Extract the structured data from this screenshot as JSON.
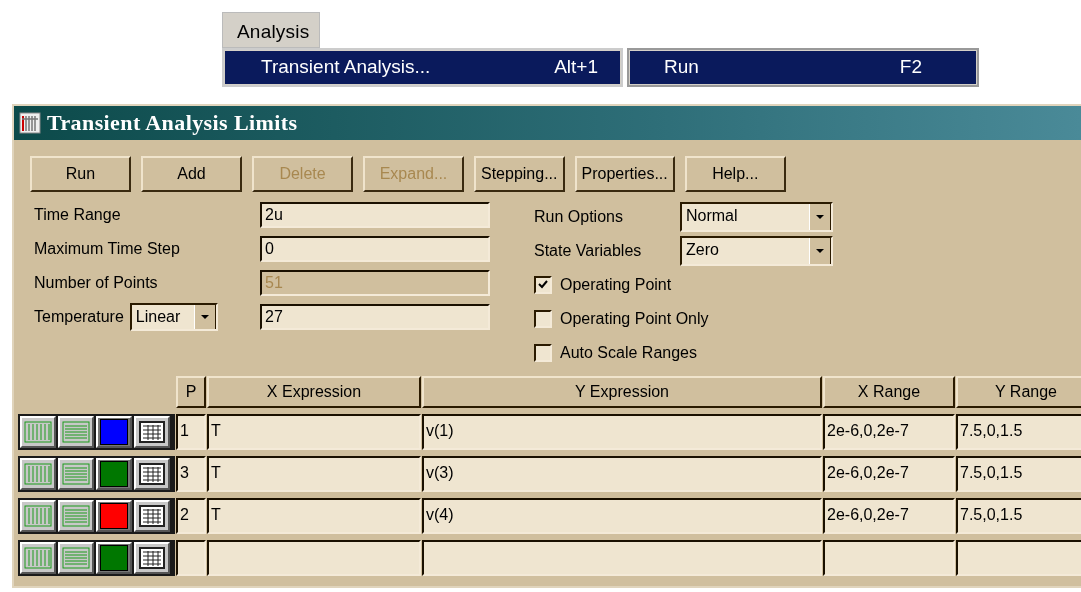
{
  "menu": {
    "title": "Analysis",
    "items": [
      {
        "label": "Transient Analysis...",
        "shortcut": "Alt+1",
        "selected": true
      }
    ],
    "submenu": [
      {
        "label": "Run",
        "shortcut": "F2",
        "selected": true
      }
    ]
  },
  "window": {
    "title": "Transient Analysis Limits"
  },
  "buttons": [
    {
      "label": "Run",
      "disabled": false
    },
    {
      "label": "Add",
      "disabled": false
    },
    {
      "label": "Delete",
      "disabled": true
    },
    {
      "label": "Expand...",
      "disabled": true
    },
    {
      "label": "Stepping...",
      "disabled": false
    },
    {
      "label": "Properties...",
      "disabled": false
    },
    {
      "label": "Help...",
      "disabled": false
    }
  ],
  "fields": [
    {
      "label": "Time Range",
      "value": "2u",
      "disabled": false
    },
    {
      "label": "Maximum Time Step",
      "value": "0",
      "disabled": false
    },
    {
      "label": "Number of Points",
      "value": "51",
      "disabled": true
    },
    {
      "label": "Temperature",
      "dropdown": "Linear",
      "value": "27",
      "disabled": false
    }
  ],
  "options": [
    {
      "label": "Run Options",
      "value": "Normal"
    },
    {
      "label": "State Variables",
      "value": "Zero"
    }
  ],
  "checkboxes": [
    {
      "label": "Operating Point",
      "checked": true
    },
    {
      "label": "Operating Point Only",
      "checked": false
    },
    {
      "label": "Auto Scale Ranges",
      "checked": false
    }
  ],
  "table": {
    "columns": [
      "P",
      "X Expression",
      "Y Expression",
      "X Range",
      "Y Range"
    ],
    "rows": [
      {
        "color": "#0000ff",
        "cells": [
          "1",
          "T",
          "v(1)",
          "2e-6,0,2e-7",
          "7.5,0,1.5"
        ]
      },
      {
        "color": "#007700",
        "cells": [
          "3",
          "T",
          "v(3)",
          "2e-6,0,2e-7",
          "7.5,0,1.5"
        ]
      },
      {
        "color": "#ff0000",
        "cells": [
          "2",
          "T",
          "v(4)",
          "2e-6,0,2e-7",
          "7.5,0,1.5"
        ]
      },
      {
        "color": "#007700",
        "cells": [
          "",
          "",
          "",
          "",
          ""
        ]
      }
    ]
  }
}
